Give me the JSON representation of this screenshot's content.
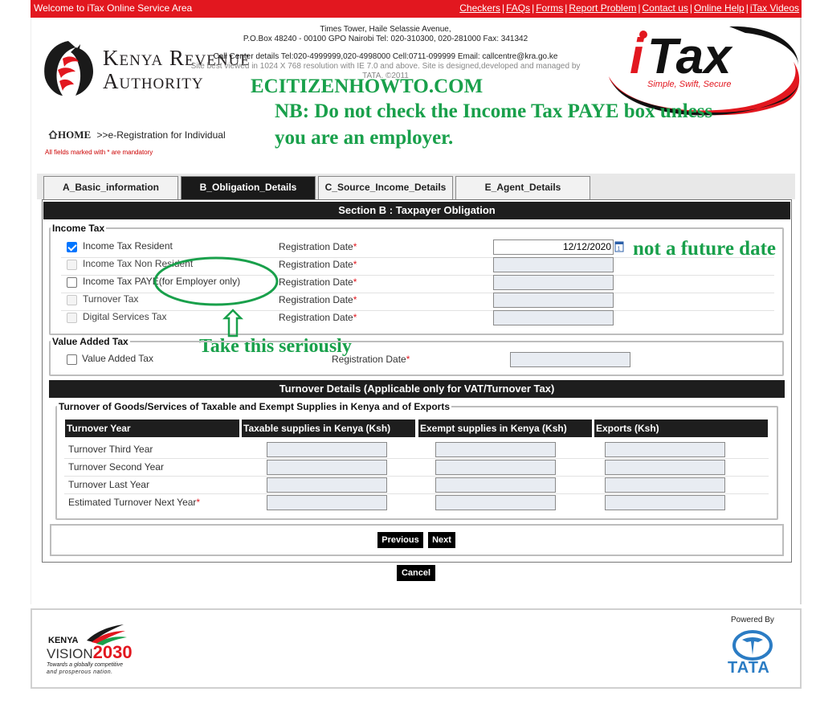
{
  "topbar": {
    "welcome": "Welcome to iTax Online Service Area",
    "links": [
      "Checkers",
      "FAQs",
      "Forms",
      "Report Problem",
      "Contact us",
      "Online Help",
      "iTax Videos"
    ]
  },
  "header": {
    "org_line1": "Kenya Revenue",
    "org_line2": "Authority",
    "itax_tagline": "Simple, Swift, Secure"
  },
  "notes": {
    "site": "ECITIZENHOWTO.COM",
    "nb": "NB: Do not check the Income Tax PAYE box unless you are an employer.",
    "future": "not a future date",
    "serious": "Take this seriously"
  },
  "breadcrumb": {
    "home": "HOME",
    "path": ">>e-Registration for Individual",
    "mandatory": "All fields marked with * are mandatory"
  },
  "tabs": [
    {
      "label": "A_Basic_information"
    },
    {
      "label": "B_Obligation_Details"
    },
    {
      "label": "C_Source_Income_Details"
    },
    {
      "label": "E_Agent_Details"
    }
  ],
  "section_b": {
    "title": "Section B : Taxpayer Obligation",
    "income_tax_legend": "Income Tax",
    "date_label": "Registration Date",
    "required_mark": "*",
    "income_rows": [
      {
        "label": "Income Tax Resident",
        "checked": true,
        "enabled": true,
        "date": "12/12/2020"
      },
      {
        "label": "Income Tax Non Resident",
        "checked": false,
        "enabled": false,
        "date": ""
      },
      {
        "label": "Income Tax PAYE(for Employer only)",
        "checked": false,
        "enabled": true,
        "date": ""
      },
      {
        "label": "Turnover Tax",
        "checked": false,
        "enabled": false,
        "date": ""
      },
      {
        "label": "Digital Services Tax",
        "checked": false,
        "enabled": false,
        "date": ""
      }
    ],
    "vat_legend": "Value Added Tax",
    "vat_row": {
      "label": "Value Added Tax",
      "checked": false,
      "date": ""
    }
  },
  "turnover": {
    "title": "Turnover Details (Applicable only for VAT/Turnover Tax)",
    "legend": "Turnover of Goods/Services of Taxable and Exempt Supplies in Kenya and of Exports",
    "columns": [
      "Turnover Year",
      "Taxable supplies in Kenya (Ksh)",
      "Exempt supplies in Kenya (Ksh)",
      "Exports (Ksh)"
    ],
    "rows": [
      {
        "label": "Turnover Third Year",
        "required": false
      },
      {
        "label": "Turnover Second Year",
        "required": false
      },
      {
        "label": "Turnover Last Year",
        "required": false
      },
      {
        "label": "Estimated Turnover Next Year",
        "required": true
      }
    ]
  },
  "buttons": {
    "previous": "Previous",
    "next": "Next",
    "cancel": "Cancel"
  },
  "footer": {
    "line1": "Times Tower, Haile Selassie Avenue,",
    "line2": "P.O.Box 48240 - 00100 GPO Nairobi Tel: 020-310300, 020-281000 Fax: 341342",
    "line3": "Call Center details Tel:020-4999999,020-4998000 Cell:0711-099999 Email: callcentre@kra.go.ke",
    "line4": "Site best viewed in 1024 X 768 resolution with IE 7.0 and above. Site is designed,developed and managed by TATA. ©2011",
    "powered_by": "Powered By",
    "tata": "TATA",
    "vision_kenya": "KENYA",
    "vision_word": "VISION",
    "vision_year": "2030",
    "vision_tag1": "Towards a globally competitive",
    "vision_tag2": "and prosperous nation."
  },
  "colors": {
    "brand_red": "#e2171f",
    "note_green": "#19a04b",
    "header_dark": "#1e1e1e"
  }
}
